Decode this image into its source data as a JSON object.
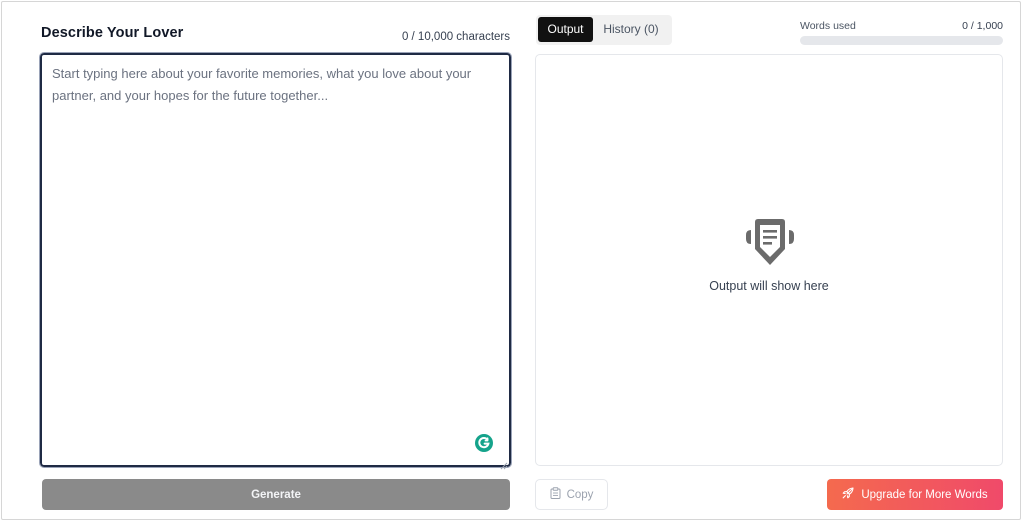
{
  "left": {
    "title": "Describe Your Lover",
    "char_count": "0 / 10,000 characters",
    "textarea": {
      "value": "",
      "placeholder": "Start typing here about your favorite memories, what you love about your partner, and your hopes for the future together..."
    },
    "generate_label": "Generate"
  },
  "right": {
    "tabs": [
      {
        "label": "Output",
        "active": true
      },
      {
        "label": "History (0)",
        "active": false
      }
    ],
    "words_used": {
      "label": "Words used",
      "value": "0 / 1,000",
      "fraction": 0
    },
    "output": {
      "empty_text": "Output will show here",
      "icon": "empty-output-icon"
    },
    "copy_label": "Copy",
    "upgrade_label": "Upgrade for More Words"
  },
  "colors": {
    "accent_start": "#f46a4e",
    "accent_end": "#f04a6a",
    "generate_bg": "#8a8a8a",
    "active_tab": "#111111",
    "grammarly": "#15a38b"
  }
}
